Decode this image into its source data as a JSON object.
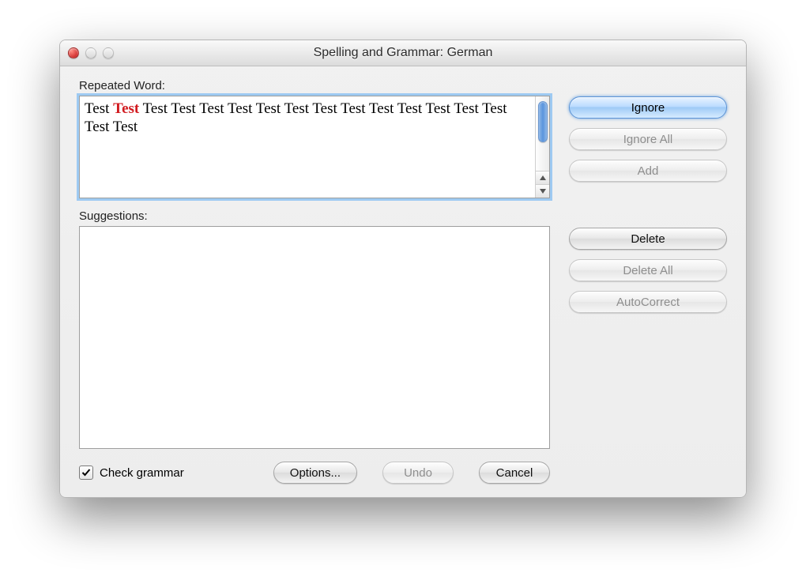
{
  "window": {
    "title": "Spelling and Grammar: German"
  },
  "labels": {
    "repeated_word": "Repeated Word:",
    "suggestions": "Suggestions:"
  },
  "text_preview": {
    "before": "Test ",
    "highlight": "Test",
    "after": " Test Test Test Test Test Test Test Test Test Test Test Test Test Test Test"
  },
  "buttons": {
    "ignore": "Ignore",
    "ignore_all": "Ignore All",
    "add": "Add",
    "delete": "Delete",
    "delete_all": "Delete All",
    "autocorrect": "AutoCorrect",
    "options": "Options...",
    "undo": "Undo",
    "cancel": "Cancel"
  },
  "checkbox": {
    "label": "Check grammar",
    "checked": true
  }
}
